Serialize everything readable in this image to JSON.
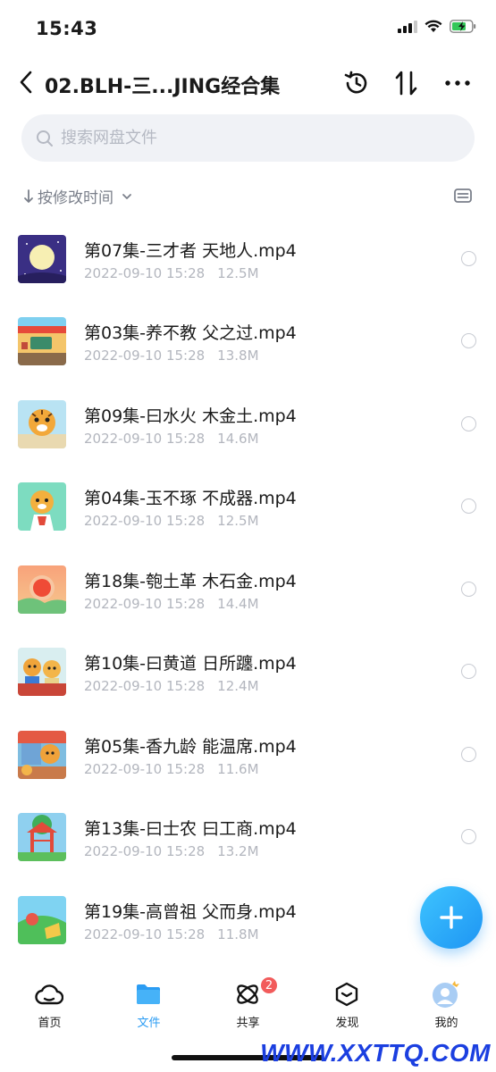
{
  "status_bar": {
    "time": "15:43",
    "icons": [
      "signal-icon",
      "wifi-icon",
      "battery-charging-icon"
    ]
  },
  "header": {
    "title": "02.BLH-三...JING经合集",
    "icons": [
      "back-icon",
      "history-icon",
      "sort-icon",
      "more-icon"
    ]
  },
  "search": {
    "placeholder": "搜索网盘文件",
    "value": ""
  },
  "sort": {
    "label": "按修改时间"
  },
  "files": [
    {
      "name": "第07集-三才者 天地人.mp4",
      "date": "2022-09-10 15:28",
      "size": "12.5M",
      "thumb": "moon-night"
    },
    {
      "name": "第03集-养不教 父之过.mp4",
      "date": "2022-09-10 15:28",
      "size": "13.8M",
      "thumb": "house-scene"
    },
    {
      "name": "第09集-曰水火 木金土.mp4",
      "date": "2022-09-10 15:28",
      "size": "14.6M",
      "thumb": "tiger-face"
    },
    {
      "name": "第04集-玉不琢 不成器.mp4",
      "date": "2022-09-10 15:28",
      "size": "12.5M",
      "thumb": "tiger-green"
    },
    {
      "name": "第18集-匏土革 木石金.mp4",
      "date": "2022-09-10 15:28",
      "size": "14.4M",
      "thumb": "sunset"
    },
    {
      "name": "第10集-曰黄道 日所躔.mp4",
      "date": "2022-09-10 15:28",
      "size": "12.4M",
      "thumb": "tigers-two"
    },
    {
      "name": "第05集-香九龄 能温席.mp4",
      "date": "2022-09-10 15:28",
      "size": "11.6M",
      "thumb": "tiger-room"
    },
    {
      "name": "第13集-曰士农 曰工商.mp4",
      "date": "2022-09-10 15:28",
      "size": "13.2M",
      "thumb": "pavilion"
    },
    {
      "name": "第19集-高曾祖 父而身.mp4",
      "date": "2022-09-10 15:28",
      "size": "11.8M",
      "thumb": "green-hill"
    }
  ],
  "tabs": [
    {
      "label": "首页",
      "icon": "cloud-icon",
      "active": false
    },
    {
      "label": "文件",
      "icon": "folder-icon",
      "active": true
    },
    {
      "label": "共享",
      "icon": "share-orbit-icon",
      "active": false,
      "badge": "2"
    },
    {
      "label": "发现",
      "icon": "discover-box-icon",
      "active": false
    },
    {
      "label": "我的",
      "icon": "avatar-icon",
      "active": false
    }
  ],
  "watermark": "WWW.XXTTQ.COM",
  "colors": {
    "accent": "#2b9cf3",
    "badge": "#f25b5b",
    "meta": "#b3b6be"
  }
}
